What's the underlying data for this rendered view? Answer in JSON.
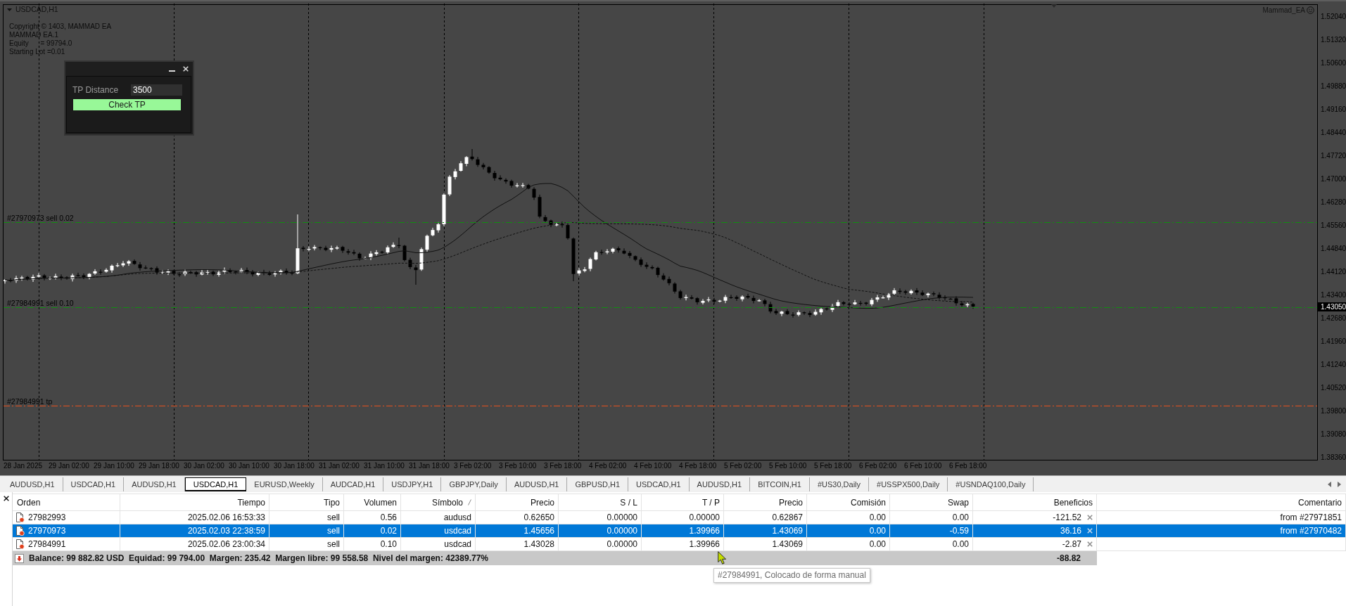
{
  "chart": {
    "title": "USDCAD,H1",
    "info_lines": [
      "Copyright © 1403, MAMMAD EA",
      "MAMMAD EA.1",
      "Equity      = 99794.0",
      "Starting Lot =0.01"
    ],
    "expert": "Mammad_EA",
    "price_axis": [
      "1.52040",
      "1.51320",
      "1.50600",
      "1.49880",
      "1.49160",
      "1.48440",
      "1.47720",
      "1.47000",
      "1.46280",
      "1.45560",
      "1.44840",
      "1.44120",
      "1.43400",
      "1.42680",
      "1.41960",
      "1.41240",
      "1.40520",
      "1.39800",
      "1.39080",
      "1.38360"
    ],
    "bid_price": "1.43050",
    "time_axis": [
      "28 Jan 2025",
      "29 Jan 02:00",
      "29 Jan 10:00",
      "29 Jan 18:00",
      "30 Jan 02:00",
      "30 Jan 10:00",
      "30 Jan 18:00",
      "31 Jan 02:00",
      "31 Jan 10:00",
      "31 Jan 18:00",
      "3 Feb 02:00",
      "3 Feb 10:00",
      "3 Feb 18:00",
      "4 Feb 02:00",
      "4 Feb 10:00",
      "4 Feb 18:00",
      "5 Feb 02:00",
      "5 Feb 10:00",
      "5 Feb 18:00",
      "6 Feb 02:00",
      "6 Feb 10:00",
      "6 Feb 18:00"
    ],
    "trade_labels": [
      {
        "text": "#27970973 sell 0.02",
        "kind": "entry"
      },
      {
        "text": "#27984991 sell 0.10",
        "kind": "entry"
      },
      {
        "text": "#27984991 tp",
        "kind": "tp"
      }
    ]
  },
  "panel": {
    "field_label": "TP Distance",
    "field_value": "3500",
    "button": "Check TP"
  },
  "tabs": [
    {
      "label": "AUDUSD,H1",
      "selected": false
    },
    {
      "label": "USDCAD,H1",
      "selected": false
    },
    {
      "label": "AUDUSD,H1",
      "selected": false
    },
    {
      "label": "USDCAD,H1",
      "selected": true
    },
    {
      "label": "EURUSD,Weekly",
      "selected": false
    },
    {
      "label": "AUDCAD,H1",
      "selected": false
    },
    {
      "label": "USDJPY,H1",
      "selected": false
    },
    {
      "label": "GBPJPY,Daily",
      "selected": false
    },
    {
      "label": "AUDUSD,H1",
      "selected": false
    },
    {
      "label": "GBPUSD,H1",
      "selected": false
    },
    {
      "label": "USDCAD,H1",
      "selected": false
    },
    {
      "label": "AUDUSD,H1",
      "selected": false
    },
    {
      "label": "BITCOIN,H1",
      "selected": false
    },
    {
      "label": "#US30,Daily",
      "selected": false
    },
    {
      "label": "#USSPX500,Daily",
      "selected": false
    },
    {
      "label": "#USNDAQ100,Daily",
      "selected": false
    }
  ],
  "terminal": {
    "columns": [
      {
        "label": "Orden",
        "sorted": false
      },
      {
        "label": "Tiempo",
        "sorted": false
      },
      {
        "label": "Tipo",
        "sorted": false
      },
      {
        "label": "Volumen",
        "sorted": false
      },
      {
        "label": "Símbolo",
        "sorted": true
      },
      {
        "label": "Precio",
        "sorted": false
      },
      {
        "label": "S / L",
        "sorted": false
      },
      {
        "label": "T / P",
        "sorted": false
      },
      {
        "label": "Precio",
        "sorted": false
      },
      {
        "label": "Comisión",
        "sorted": false
      },
      {
        "label": "Swap",
        "sorted": false
      },
      {
        "label": "Beneficios",
        "sorted": false
      },
      {
        "label": "Comentario",
        "sorted": false
      }
    ],
    "rows": [
      {
        "cells": [
          "27982993",
          "2025.02.06 16:53:33",
          "sell",
          "0.56",
          "audusd",
          "0.62650",
          "0.00000",
          "0.00000",
          "0.62867",
          "0.00",
          "0.00",
          "-121.52",
          "from #27971851"
        ],
        "selected": false
      },
      {
        "cells": [
          "27970973",
          "2025.02.03 22:38:59",
          "sell",
          "0.02",
          "usdcad",
          "1.45656",
          "0.00000",
          "1.39966",
          "1.43069",
          "0.00",
          "-0.59",
          "36.16",
          "from #27970482"
        ],
        "selected": true
      },
      {
        "cells": [
          "27984991",
          "2025.02.06 23:00:34",
          "sell",
          "0.10",
          "usdcad",
          "1.43028",
          "0.00000",
          "1.39966",
          "1.43069",
          "0.00",
          "0.00",
          "-2.87"
        ],
        "selected": false
      }
    ],
    "summary": "Balance: 99 882.82 USD  Equidad: 99 794.00  Margen: 235.42  Margen libre: 99 558.58  Nivel del margen: 42389.77%",
    "total": "-88.82"
  },
  "tooltip": "#27984991, Colocado de forma manual"
}
